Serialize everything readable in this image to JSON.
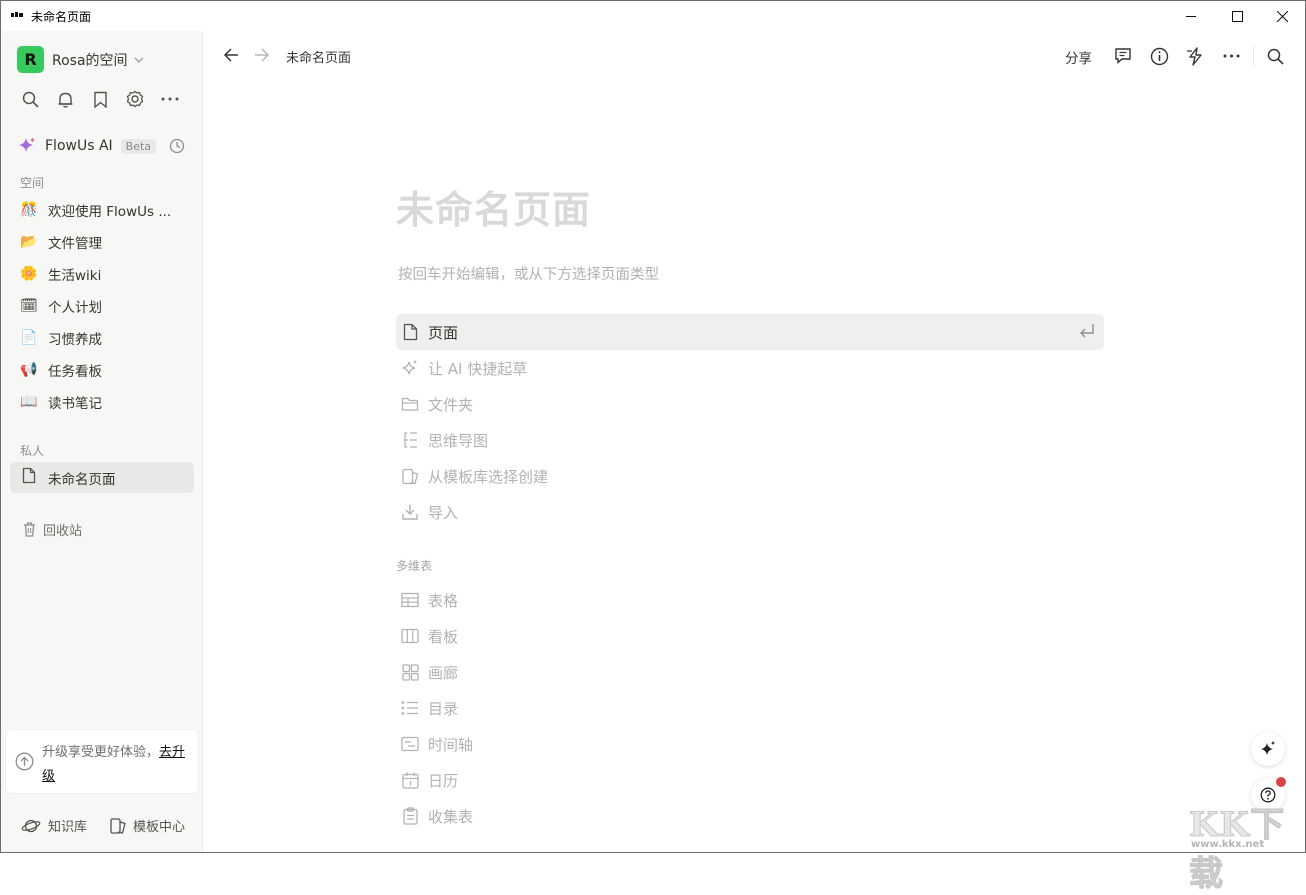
{
  "window": {
    "title": "未命名页面"
  },
  "sidebar": {
    "workspace": {
      "avatar_letter": "R",
      "name": "Rosa的空间"
    },
    "ai": {
      "label": "FlowUs AI",
      "badge": "Beta"
    },
    "space_label": "空间",
    "space_items": [
      {
        "emoji": "🎊",
        "label": "欢迎使用 FlowUs ..."
      },
      {
        "emoji": "📂",
        "label": "文件管理"
      },
      {
        "emoji": "🌼",
        "label": "生活wiki"
      },
      {
        "emoji": "🗓",
        "label": "个人计划"
      },
      {
        "emoji": "📄",
        "label": "习惯养成"
      },
      {
        "emoji": "📢",
        "label": "任务看板"
      },
      {
        "emoji": "📖",
        "label": "读书笔记"
      }
    ],
    "private_label": "私人",
    "private_items": [
      {
        "label": "未命名页面"
      }
    ],
    "trash_label": "回收站",
    "upgrade": {
      "text": "升级享受更好体验，",
      "link": "去升级"
    },
    "bottom": {
      "knowledge": "知识库",
      "templates": "模板中心"
    }
  },
  "topbar": {
    "breadcrumb": "未命名页面",
    "share": "分享"
  },
  "main": {
    "title": "未命名页面",
    "hint": "按回车开始编辑，或从下方选择页面类型",
    "options": [
      {
        "icon": "page-icon",
        "label": "页面"
      },
      {
        "icon": "sparkle-icon",
        "label": "让 AI 快捷起草"
      },
      {
        "icon": "folder-icon",
        "label": "文件夹"
      },
      {
        "icon": "mindmap-icon",
        "label": "思维导图"
      },
      {
        "icon": "template-icon",
        "label": "从模板库选择创建"
      },
      {
        "icon": "import-icon",
        "label": "导入"
      }
    ],
    "table_group_label": "多维表",
    "table_options": [
      {
        "icon": "table-icon",
        "label": "表格"
      },
      {
        "icon": "board-icon",
        "label": "看板"
      },
      {
        "icon": "gallery-icon",
        "label": "画廊"
      },
      {
        "icon": "list-icon",
        "label": "目录"
      },
      {
        "icon": "timeline-icon",
        "label": "时间轴"
      },
      {
        "icon": "calendar-icon",
        "label": "日历"
      },
      {
        "icon": "form-icon",
        "label": "收集表"
      }
    ]
  },
  "watermark": {
    "text": "KK下载",
    "url": "www.kkx.net"
  }
}
